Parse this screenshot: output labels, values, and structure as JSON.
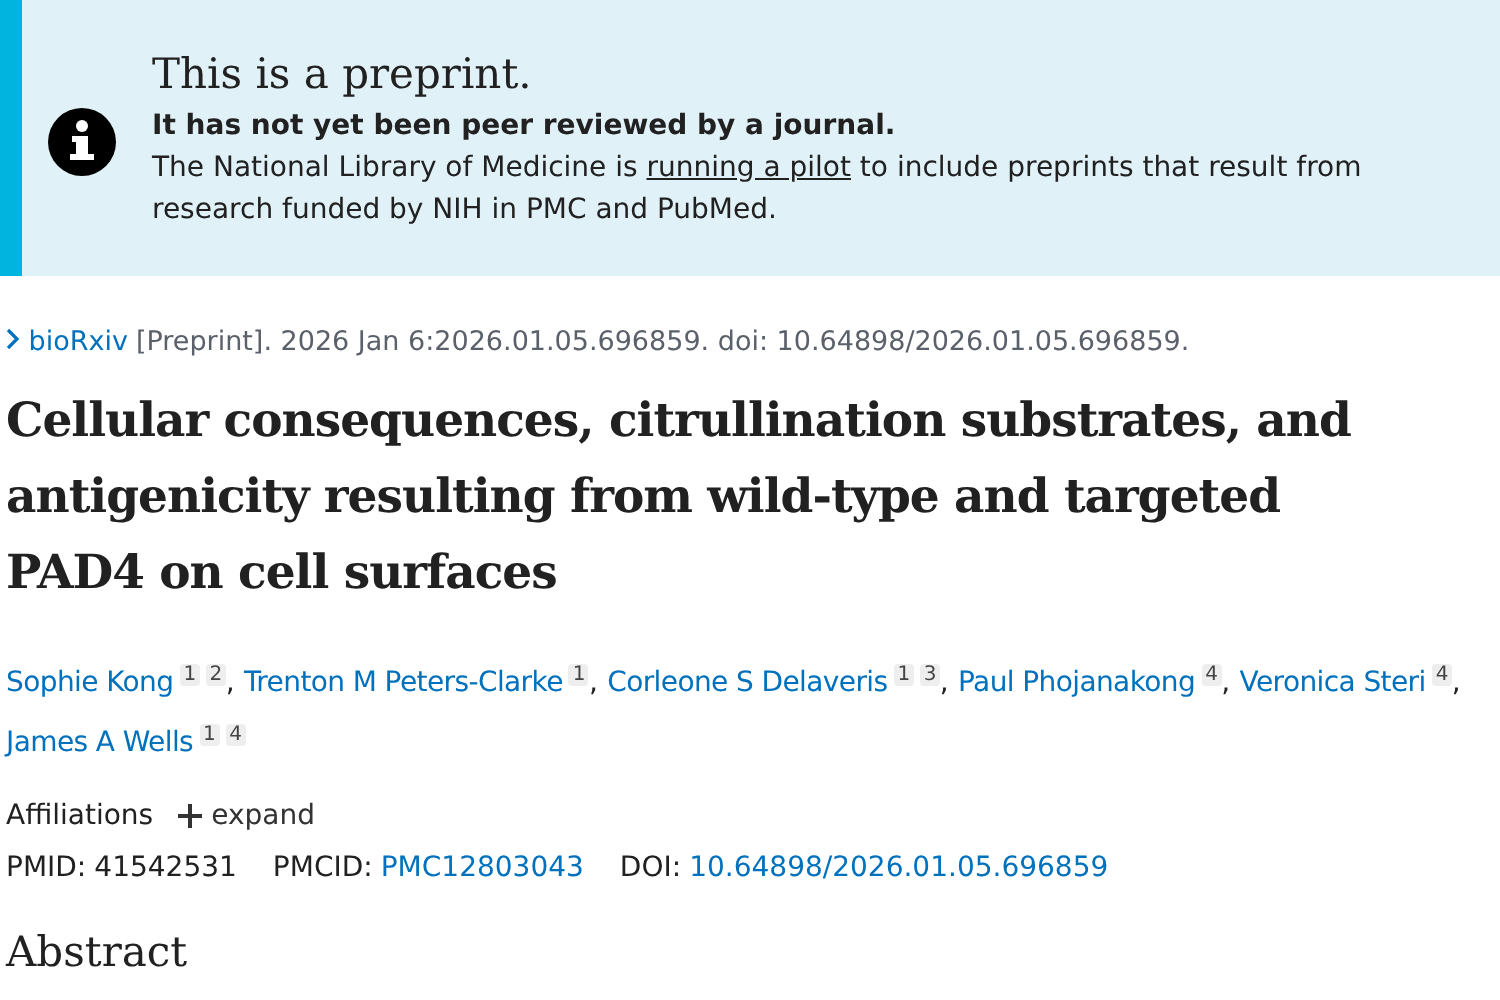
{
  "notice": {
    "title": "This is a preprint.",
    "subtitle": "It has not yet been peer reviewed by a journal.",
    "text_before": "The National Library of Medicine is",
    "link": "running a pilot",
    "text_after": "to include preprints that result from research funded by NIH in PMC and PubMed."
  },
  "citation": {
    "source": "bioRxiv",
    "details": "[Preprint]. 2026 Jan 6:2026.01.05.696859. doi: 10.64898/2026.01.05.696859."
  },
  "title": "Cellular consequences, citrullination substrates, and antigenicity resulting from wild-type and targeted PAD4 on cell surfaces",
  "authors": [
    {
      "name": "Sophie Kong",
      "affiliations": [
        "1",
        "2"
      ],
      "separator": ","
    },
    {
      "name": "Trenton M Peters-Clarke",
      "affiliations": [
        "1"
      ],
      "separator": ","
    },
    {
      "name": "Corleone S Delaveris",
      "affiliations": [
        "1",
        "3"
      ],
      "separator": ","
    },
    {
      "name": "Paul Phojanakong",
      "affiliations": [
        "4"
      ],
      "separator": ","
    },
    {
      "name": "Veronica Steri",
      "affiliations": [
        "4"
      ],
      "separator": ","
    },
    {
      "name": "James A Wells",
      "affiliations": [
        "1",
        "4"
      ]
    }
  ],
  "affiliations": {
    "label": "Affiliations",
    "toggle": "expand",
    "expanded": false
  },
  "ids": [
    {
      "label": "PMID:",
      "value": "41542531",
      "link": false
    },
    {
      "label": "PMCID:",
      "value": "PMC12803043",
      "link": true
    },
    {
      "label": "DOI:",
      "value": "10.64898/2026.01.05.696859",
      "link": true
    }
  ],
  "section_heading": "Abstract"
}
